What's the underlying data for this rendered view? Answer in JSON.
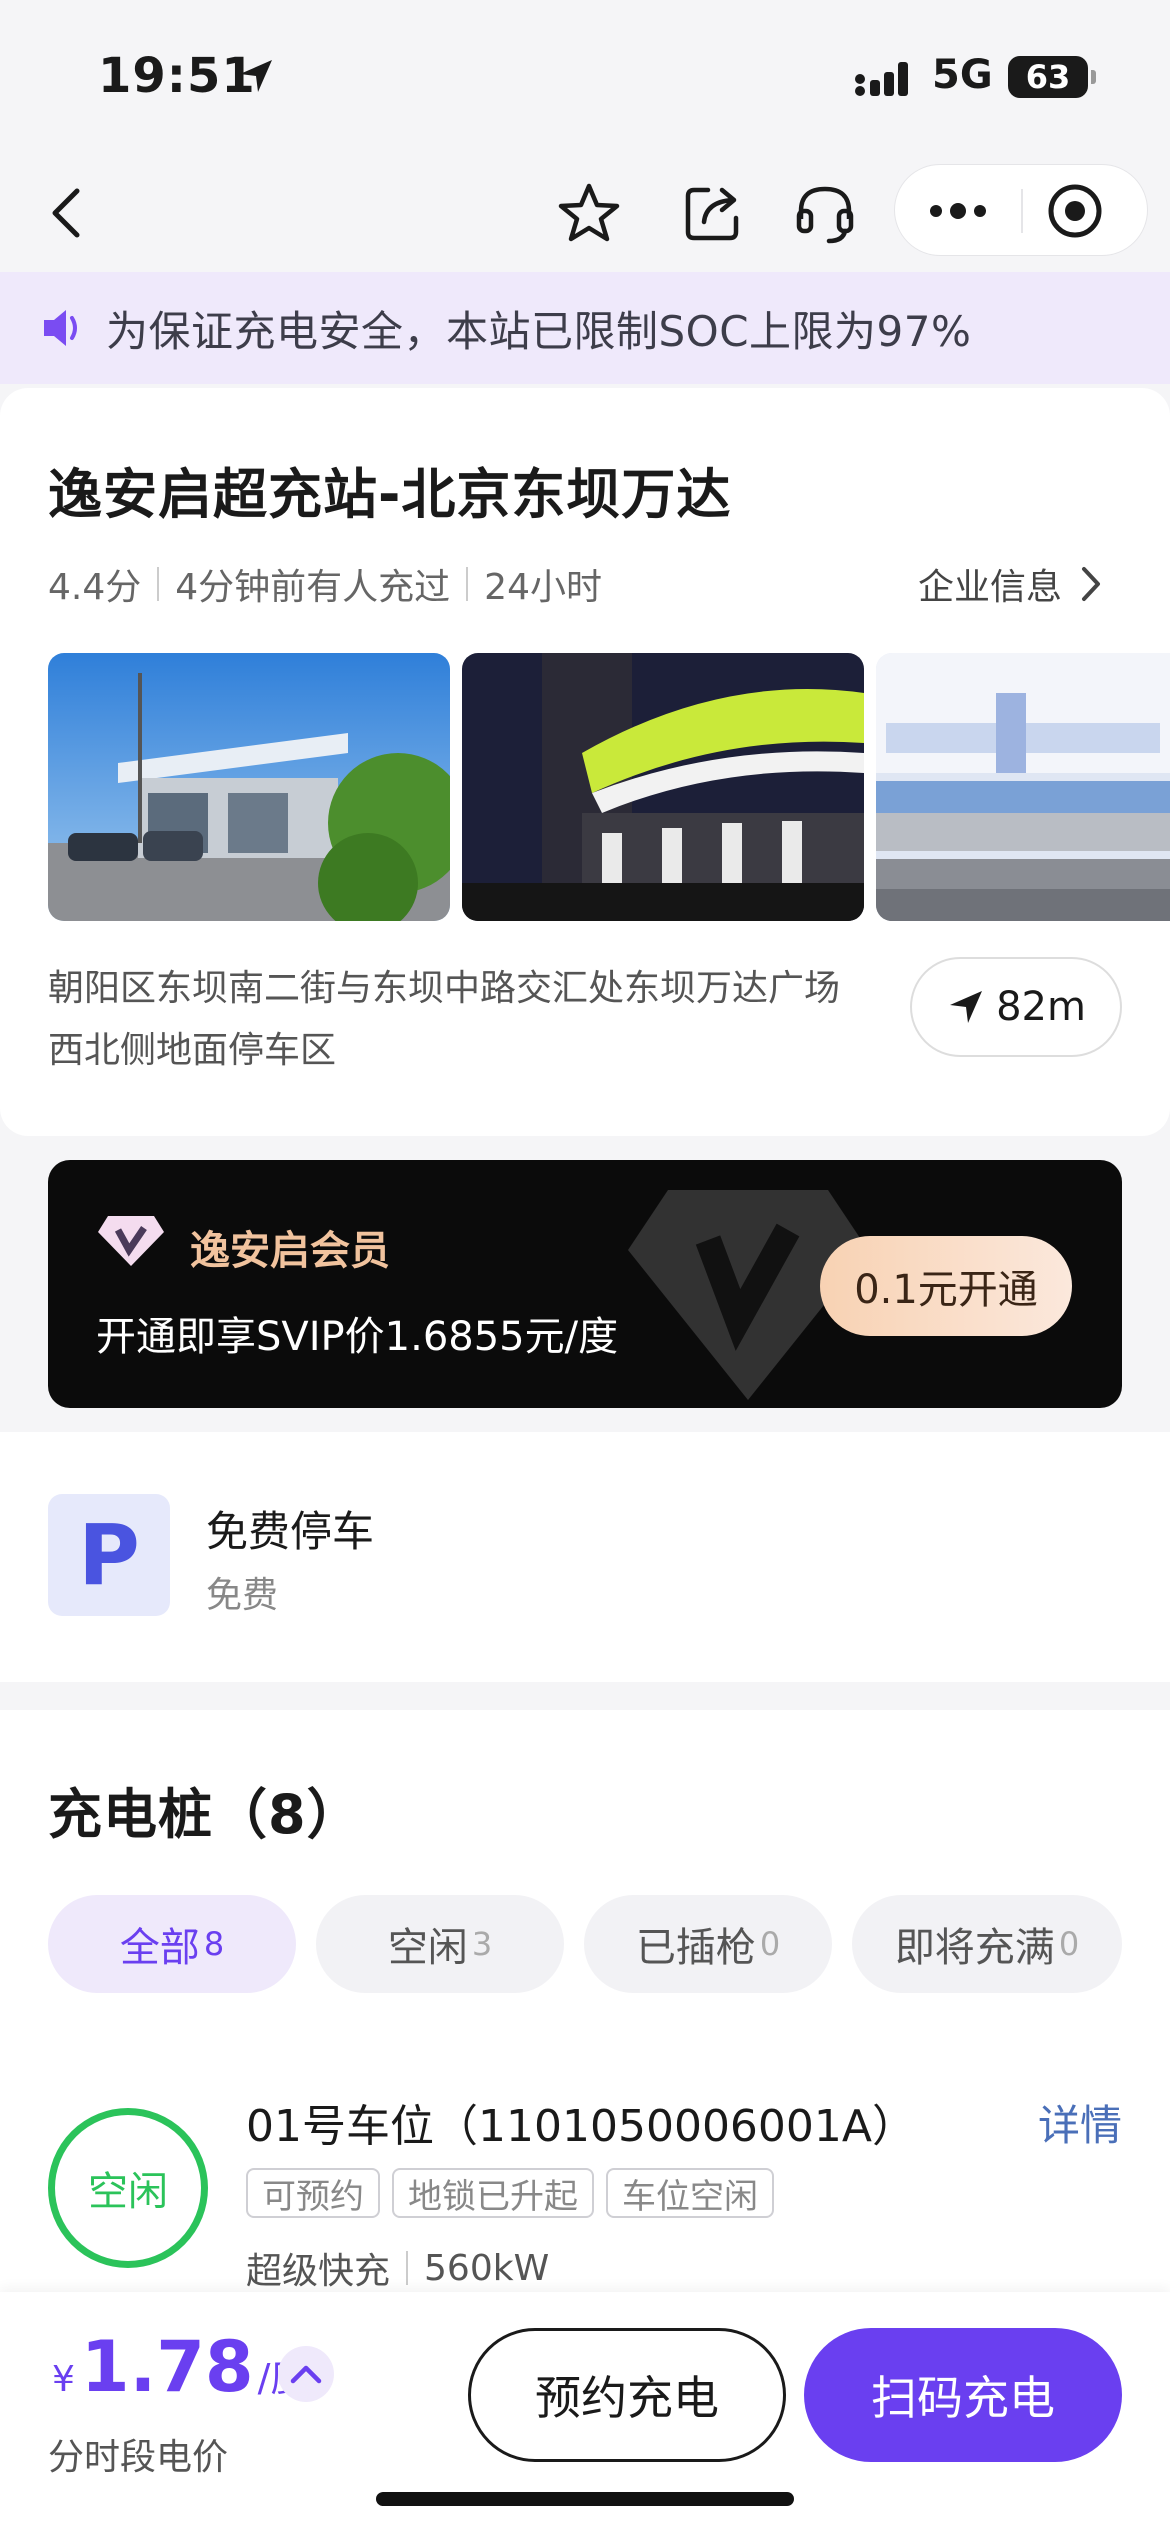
{
  "status_bar": {
    "time": "19:51",
    "network": "5G",
    "battery": "63"
  },
  "nav": {
    "icons": [
      "back-icon",
      "star-icon",
      "share-icon",
      "headset-icon",
      "more-icon",
      "target-icon"
    ]
  },
  "notice": {
    "text": "为保证充电安全，本站已限制SOC上限为97%"
  },
  "station": {
    "name": "逸安启超充站-北京东坝万达",
    "rating": "4.4分",
    "last_charged": "4分钟前有人充过",
    "hours": "24小时",
    "corp_info": "企业信息",
    "address": "朝阳区东坝南二街与东坝中路交汇处东坝万达广场西北侧地面停车区",
    "distance": "82m"
  },
  "member": {
    "title": "逸安启会员",
    "desc": "开通即享SVIP价1.6855元/度",
    "button": "0.1元开通"
  },
  "parking": {
    "icon_letter": "P",
    "title": "免费停车",
    "sub": "免费"
  },
  "piles": {
    "title": "充电桩（8）",
    "filters": [
      {
        "label": "全部",
        "count": "8"
      },
      {
        "label": "空闲",
        "count": "3"
      },
      {
        "label": "已插枪",
        "count": "0"
      },
      {
        "label": "即将充满",
        "count": "0"
      }
    ],
    "item": {
      "status": "空闲",
      "name": "01号车位（1101050006001A）",
      "detail": "详情",
      "tags": [
        "可预约",
        "地锁已升起",
        "车位空闲"
      ],
      "type": "超级快充",
      "power": "560kW"
    }
  },
  "bottom": {
    "currency": "¥",
    "price": "1.78",
    "unit": "/度",
    "note": "分时段电价",
    "reserve": "预约充电",
    "scan": "扫码充电"
  },
  "colors": {
    "accent": "#6a3ff0",
    "idle": "#2bc35a",
    "notice_bg": "#efe9fb"
  }
}
